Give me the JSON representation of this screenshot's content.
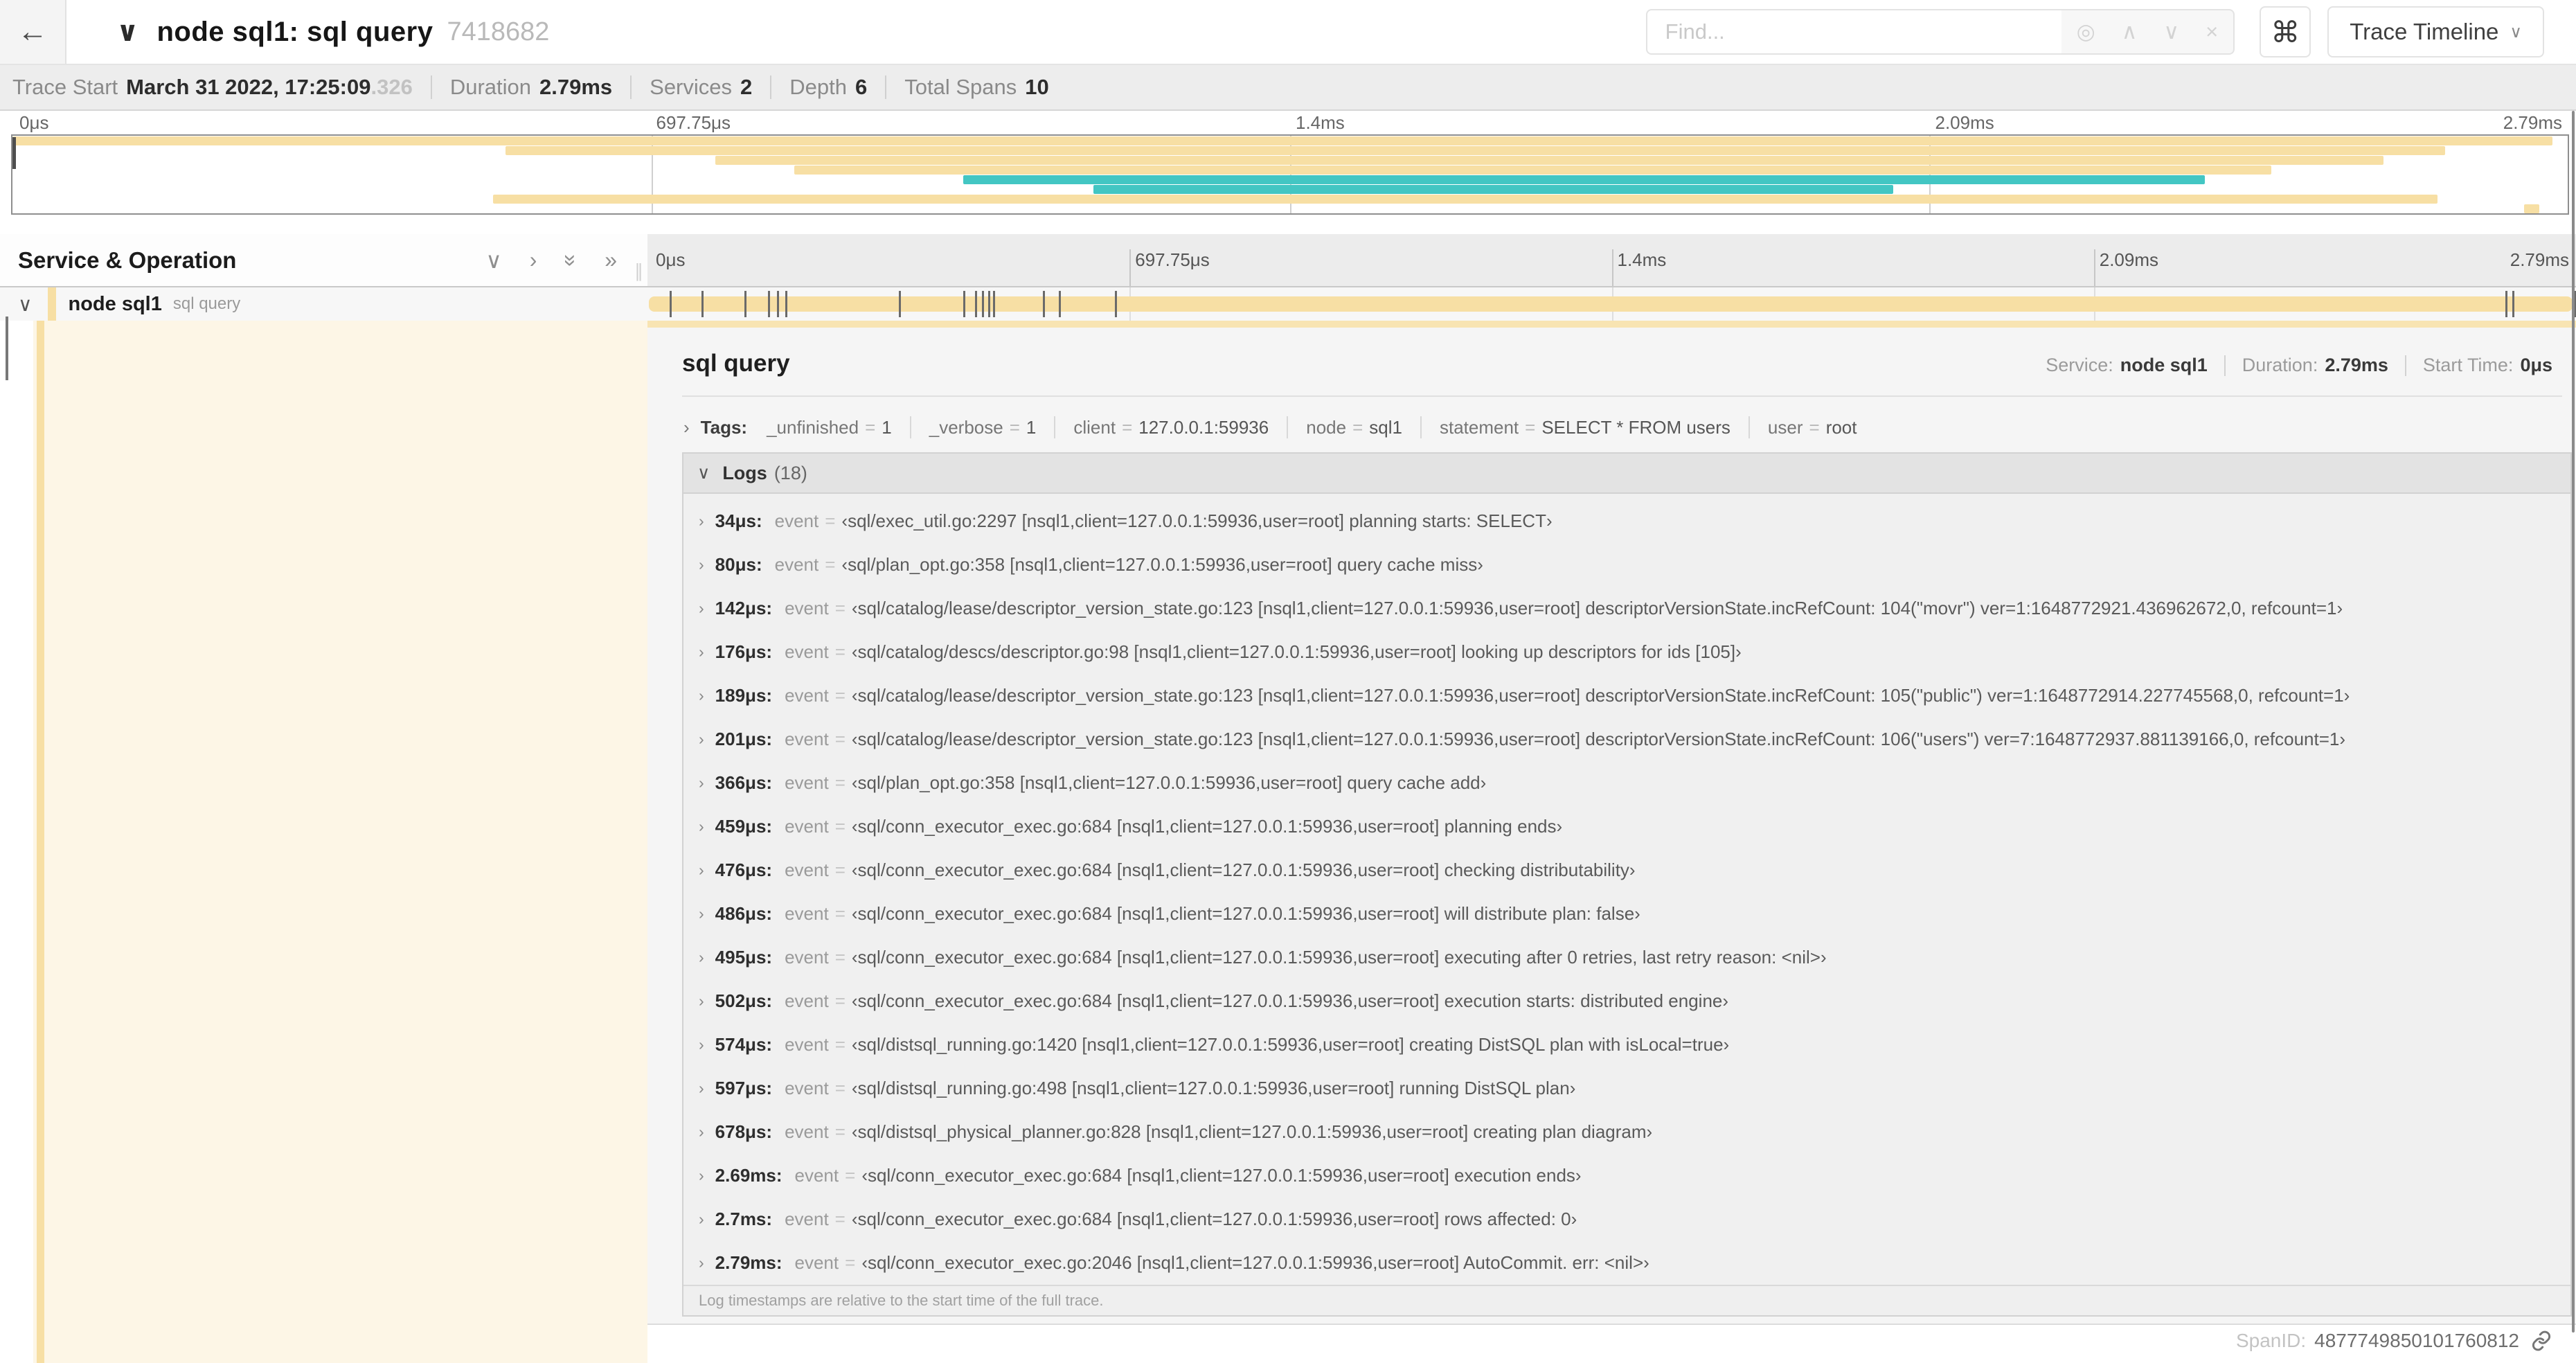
{
  "colors": {
    "tan": "#F7DFA4",
    "teal": "#43C6C3"
  },
  "topbar": {
    "back_icon": "←",
    "collapse_chevron": "∨",
    "title": "node sql1: sql query",
    "trace_id": "7418682",
    "find_placeholder": "Find...",
    "find_tools": [
      {
        "name": "locate-icon",
        "glyph": "◎"
      },
      {
        "name": "prev-result-icon",
        "glyph": "∧"
      },
      {
        "name": "next-result-icon",
        "glyph": "∨"
      },
      {
        "name": "clear-search-icon",
        "glyph": "×"
      }
    ],
    "shortcut_icon": "⌘",
    "view_selector": "Trace Timeline",
    "view_selector_chevron": "∨"
  },
  "summary": {
    "items": [
      {
        "label": "Trace Start",
        "value": "March 31 2022, 17:25:09",
        "suffix": ".326"
      },
      {
        "label": "Duration",
        "value": "2.79ms"
      },
      {
        "label": "Services",
        "value": "2"
      },
      {
        "label": "Depth",
        "value": "6"
      },
      {
        "label": "Total Spans",
        "value": "10"
      }
    ]
  },
  "timeline": {
    "duration_us": 2790,
    "ticks": [
      "0μs",
      "697.75μs",
      "1.4ms",
      "2.09ms",
      "2.79ms"
    ]
  },
  "minimap": {
    "bars": [
      {
        "row": 0,
        "start": 0,
        "end": 99.4,
        "color": "tan"
      },
      {
        "row": 1,
        "start": 19.3,
        "end": 95.2,
        "color": "tan"
      },
      {
        "row": 2,
        "start": 27.5,
        "end": 92.8,
        "color": "tan"
      },
      {
        "row": 3,
        "start": 30.6,
        "end": 88.4,
        "color": "tan"
      },
      {
        "row": 4,
        "start": 37.2,
        "end": 85.8,
        "color": "teal"
      },
      {
        "row": 5,
        "start": 42.3,
        "end": 73.6,
        "color": "teal"
      },
      {
        "row": 6,
        "start": 18.8,
        "end": 94.9,
        "color": "tan"
      },
      {
        "row": 7,
        "start": 98.3,
        "end": 98.9,
        "color": "tan"
      }
    ]
  },
  "grid_head": {
    "title": "Service & Operation",
    "icons": [
      {
        "name": "collapse-one-icon",
        "glyph": "∨"
      },
      {
        "name": "expand-one-icon",
        "glyph": "›"
      },
      {
        "name": "collapse-all-icon",
        "glyph": "»",
        "rotate": true
      },
      {
        "name": "expand-all-icon",
        "glyph": "»"
      }
    ],
    "grip": "∥"
  },
  "span_row": {
    "chevron": "∨",
    "service": "node sql1",
    "operation": "sql query"
  },
  "detail": {
    "title": "sql query",
    "info": [
      {
        "label": "Service:",
        "value": "node sql1"
      },
      {
        "label": "Duration:",
        "value": "2.79ms"
      },
      {
        "label": "Start Time:",
        "value": "0μs"
      }
    ],
    "tags_chevron": "›",
    "tags_label": "Tags:",
    "tags": [
      {
        "key": "_unfinished",
        "value": "1"
      },
      {
        "key": "_verbose",
        "value": "1"
      },
      {
        "key": "client",
        "value": "127.0.0.1:59936"
      },
      {
        "key": "node",
        "value": "sql1"
      },
      {
        "key": "statement",
        "value": "SELECT * FROM users"
      },
      {
        "key": "user",
        "value": "root"
      }
    ],
    "logs_chevron": "∨",
    "logs_label": "Logs",
    "logs_count": "(18)",
    "log_row_chevron": "›",
    "log_key": "event",
    "log_eq": "=",
    "logs": [
      {
        "time": "34μs:",
        "t_us": 34,
        "value": "‹sql/exec_util.go:2297 [nsql1,client=127.0.0.1:59936,user=root] planning starts: SELECT›"
      },
      {
        "time": "80μs:",
        "t_us": 80,
        "value": "‹sql/plan_opt.go:358 [nsql1,client=127.0.0.1:59936,user=root] query cache miss›"
      },
      {
        "time": "142μs:",
        "t_us": 142,
        "value": "‹sql/catalog/lease/descriptor_version_state.go:123 [nsql1,client=127.0.0.1:59936,user=root] descriptorVersionState.incRefCount: 104(\"movr\") ver=1:1648772921.436962672,0, refcount=1›"
      },
      {
        "time": "176μs:",
        "t_us": 176,
        "value": "‹sql/catalog/descs/descriptor.go:98 [nsql1,client=127.0.0.1:59936,user=root] looking up descriptors for ids [105]›"
      },
      {
        "time": "189μs:",
        "t_us": 189,
        "value": "‹sql/catalog/lease/descriptor_version_state.go:123 [nsql1,client=127.0.0.1:59936,user=root] descriptorVersionState.incRefCount: 105(\"public\") ver=1:1648772914.227745568,0, refcount=1›"
      },
      {
        "time": "201μs:",
        "t_us": 201,
        "value": "‹sql/catalog/lease/descriptor_version_state.go:123 [nsql1,client=127.0.0.1:59936,user=root] descriptorVersionState.incRefCount: 106(\"users\") ver=7:1648772937.881139166,0, refcount=1›"
      },
      {
        "time": "366μs:",
        "t_us": 366,
        "value": "‹sql/plan_opt.go:358 [nsql1,client=127.0.0.1:59936,user=root] query cache add›"
      },
      {
        "time": "459μs:",
        "t_us": 459,
        "value": "‹sql/conn_executor_exec.go:684 [nsql1,client=127.0.0.1:59936,user=root] planning ends›"
      },
      {
        "time": "476μs:",
        "t_us": 476,
        "value": "‹sql/conn_executor_exec.go:684 [nsql1,client=127.0.0.1:59936,user=root] checking distributability›"
      },
      {
        "time": "486μs:",
        "t_us": 486,
        "value": "‹sql/conn_executor_exec.go:684 [nsql1,client=127.0.0.1:59936,user=root] will distribute plan: false›"
      },
      {
        "time": "495μs:",
        "t_us": 495,
        "value": "‹sql/conn_executor_exec.go:684 [nsql1,client=127.0.0.1:59936,user=root] executing after 0 retries, last retry reason: <nil>›"
      },
      {
        "time": "502μs:",
        "t_us": 502,
        "value": "‹sql/conn_executor_exec.go:684 [nsql1,client=127.0.0.1:59936,user=root] execution starts: distributed engine›"
      },
      {
        "time": "574μs:",
        "t_us": 574,
        "value": "‹sql/distsql_running.go:1420 [nsql1,client=127.0.0.1:59936,user=root] creating DistSQL plan with isLocal=true›"
      },
      {
        "time": "597μs:",
        "t_us": 597,
        "value": "‹sql/distsql_running.go:498 [nsql1,client=127.0.0.1:59936,user=root] running DistSQL plan›"
      },
      {
        "time": "678μs:",
        "t_us": 678,
        "value": "‹sql/distsql_physical_planner.go:828 [nsql1,client=127.0.0.1:59936,user=root] creating plan diagram›"
      },
      {
        "time": "2.69ms:",
        "t_us": 2690,
        "value": "‹sql/conn_executor_exec.go:684 [nsql1,client=127.0.0.1:59936,user=root] execution ends›"
      },
      {
        "time": "2.7ms:",
        "t_us": 2700,
        "value": "‹sql/conn_executor_exec.go:684 [nsql1,client=127.0.0.1:59936,user=root] rows affected: 0›"
      },
      {
        "time": "2.79ms:",
        "t_us": 2790,
        "value": "‹sql/conn_executor_exec.go:2046 [nsql1,client=127.0.0.1:59936,user=root] AutoCommit. err: <nil>›"
      }
    ],
    "footer": "Log timestamps are relative to the start time of the full trace.",
    "span_id_label": "SpanID:",
    "span_id": "4877749850101760812"
  }
}
